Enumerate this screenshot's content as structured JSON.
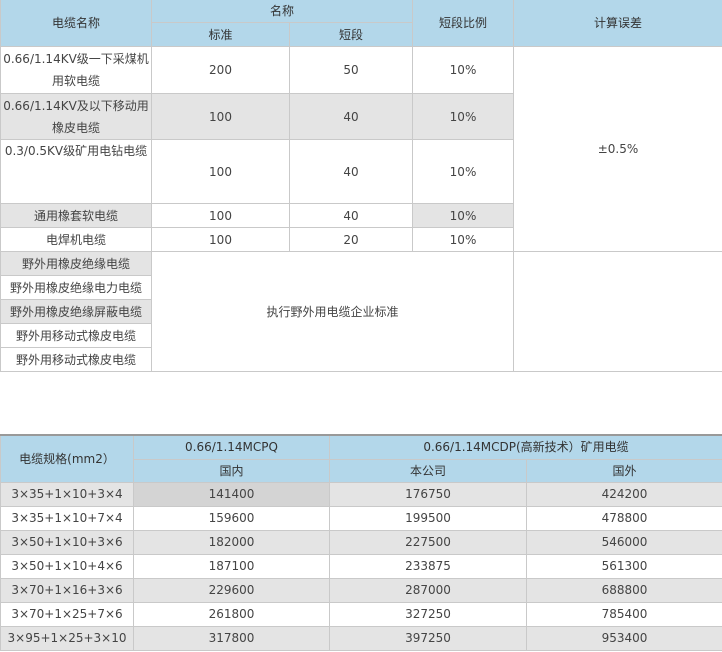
{
  "table1": {
    "headers": {
      "cable_name": "电缆名称",
      "name_group": "名称",
      "standard": "标准",
      "short": "短段",
      "short_ratio": "短段比例",
      "calc_error": "计算误差"
    },
    "rows": [
      {
        "name": "0.66/1.14KV级一下采煤机用软电缆",
        "standard": "200",
        "short": "50",
        "ratio": "10%"
      },
      {
        "name": "0.66/1.14KV及以下移动用橡皮电缆",
        "standard": "100",
        "short": "40",
        "ratio": "10%"
      },
      {
        "name": "0.3/0.5KV级矿用电钻电缆",
        "standard": "100",
        "short": "40",
        "ratio": "10%"
      },
      {
        "name": "通用橡套软电缆",
        "standard": "100",
        "short": "40",
        "ratio": "10%"
      },
      {
        "name": "电焊机电缆",
        "standard": "100",
        "short": "20",
        "ratio": "10%"
      }
    ],
    "error_value": "±0.5%",
    "field_rows": [
      "野外用橡皮绝缘电缆",
      "野外用橡皮绝缘电力电缆",
      "野外用橡皮绝缘屏蔽电缆",
      "野外用移动式橡皮电缆",
      "野外用移动式橡皮电缆"
    ],
    "field_note": "执行野外用电缆企业标准"
  },
  "table2": {
    "headers": {
      "spec": "电缆规格(mm2）",
      "mcpq": "0.66/1.14MCPQ",
      "mcdp": "0.66/1.14MCDP(高新技术）矿用电缆",
      "domestic": "国内",
      "company": "本公司",
      "foreign": "国外"
    },
    "rows": [
      {
        "spec": "3×35+1×10+3×4",
        "domestic": "141400",
        "company": "176750",
        "foreign": "424200"
      },
      {
        "spec": "3×35+1×10+7×4",
        "domestic": "159600",
        "company": "199500",
        "foreign": "478800"
      },
      {
        "spec": "3×50+1×10+3×6",
        "domestic": "182000",
        "company": "227500",
        "foreign": "546000"
      },
      {
        "spec": "3×50+1×10+4×6",
        "domestic": "187100",
        "company": "233875",
        "foreign": "561300"
      },
      {
        "spec": "3×70+1×16+3×6",
        "domestic": "229600",
        "company": "287000",
        "foreign": "688800"
      },
      {
        "spec": "3×70+1×25+7×6",
        "domestic": "261800",
        "company": "327250",
        "foreign": "785400"
      },
      {
        "spec": "3×95+1×25+3×10",
        "domestic": "317800",
        "company": "397250",
        "foreign": "953400"
      }
    ]
  }
}
